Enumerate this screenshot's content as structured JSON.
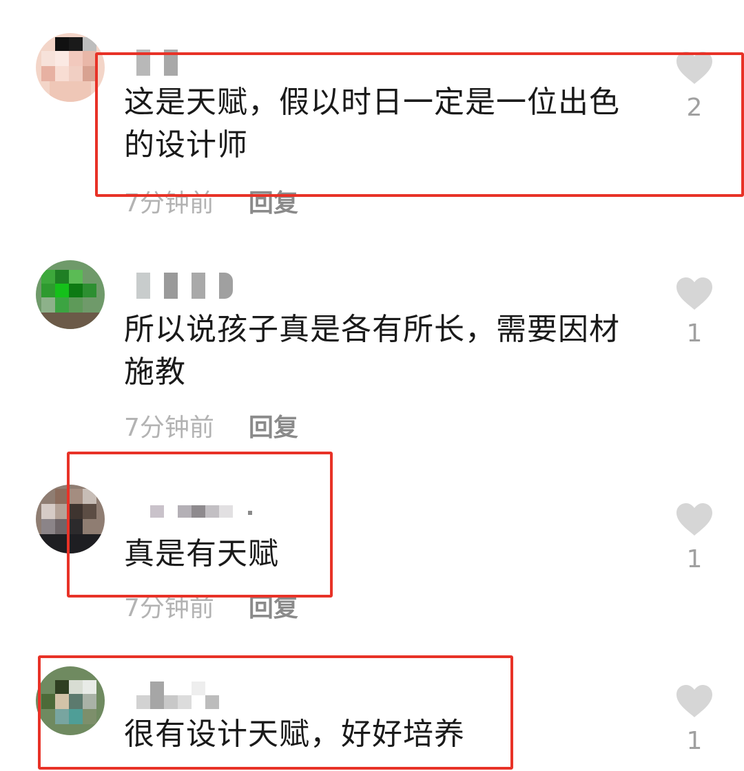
{
  "comments": [
    {
      "text": "这是天赋，假以时日一定是一位出色的设计师",
      "time": "7分钟前",
      "reply_label": "回复",
      "likes": "2",
      "avatar": "girl-cartoon-avatar"
    },
    {
      "text": "所以说孩子真是各有所长，需要因材施教",
      "time": "7分钟前",
      "reply_label": "回复",
      "likes": "1",
      "avatar": "green-plant-avatar"
    },
    {
      "text": "真是有天赋",
      "time": "7分钟前",
      "reply_label": "回复",
      "likes": "1",
      "avatar": "person-avatar"
    },
    {
      "text": "很有设计天赋，好好培养",
      "likes": "1",
      "avatar": "green-outdoor-avatar"
    }
  ],
  "colors": {
    "highlight": "#e83227",
    "like_icon": "#d6d6d6",
    "time_text": "#b3b3b3",
    "reply_text": "#8a8a8a"
  },
  "icons": {
    "like": "heart-icon"
  }
}
